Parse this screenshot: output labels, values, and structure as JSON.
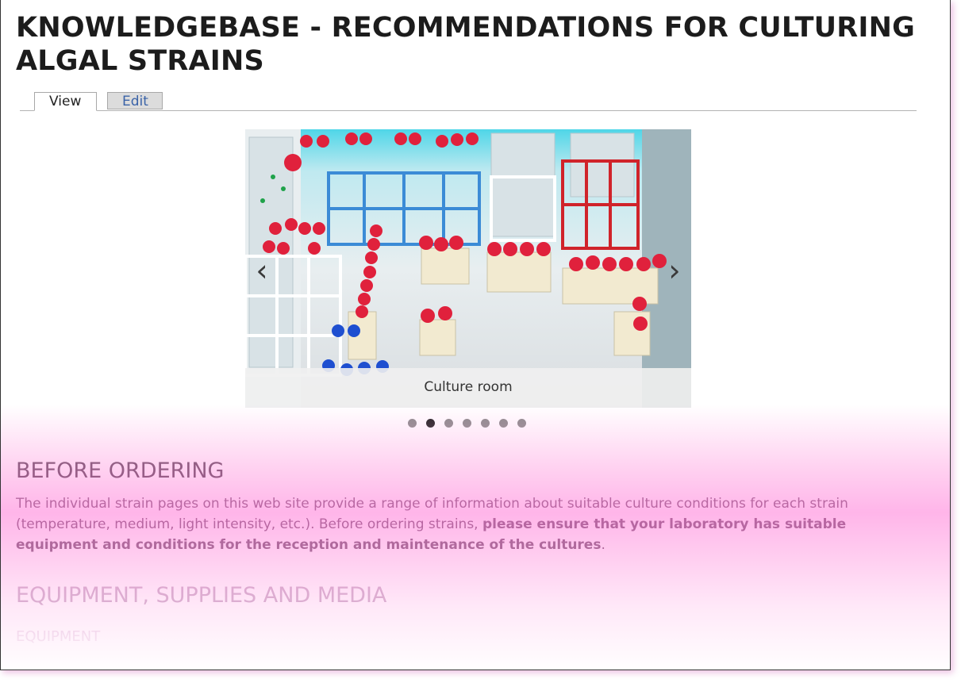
{
  "page": {
    "title": "KNOWLEDGEBASE - RECOMMENDATIONS FOR CULTURING ALGAL STRAINS"
  },
  "tabs": [
    {
      "label": "View",
      "active": true
    },
    {
      "label": "Edit",
      "active": false
    }
  ],
  "slider": {
    "caption": "Culture room",
    "prev_icon": "chevron-left-icon",
    "next_icon": "chevron-right-icon",
    "dot_count": 7,
    "active_dot": 2
  },
  "sections": {
    "before_ordering": {
      "heading": "BEFORE ORDERING",
      "text_plain": "The individual strain pages on this web site provide a range of information about suitable culture conditions for each strain (temperature, medium, light intensity, etc.). Before ordering strains, ",
      "text_bold": "please ensure that your laboratory has suitable equipment and conditions for the reception and maintenance of the cultures",
      "text_end": "."
    },
    "equipment": {
      "heading": "EQUIPMENT, SUPPLIES AND MEDIA",
      "subheading": "EQUIPMENT"
    }
  },
  "colors": {
    "overlay": "#ff8ad8",
    "tab_edit_text": "#3a63a8",
    "dot_active": "#1f1f1f",
    "dot_inactive": "#8a8a8a"
  }
}
